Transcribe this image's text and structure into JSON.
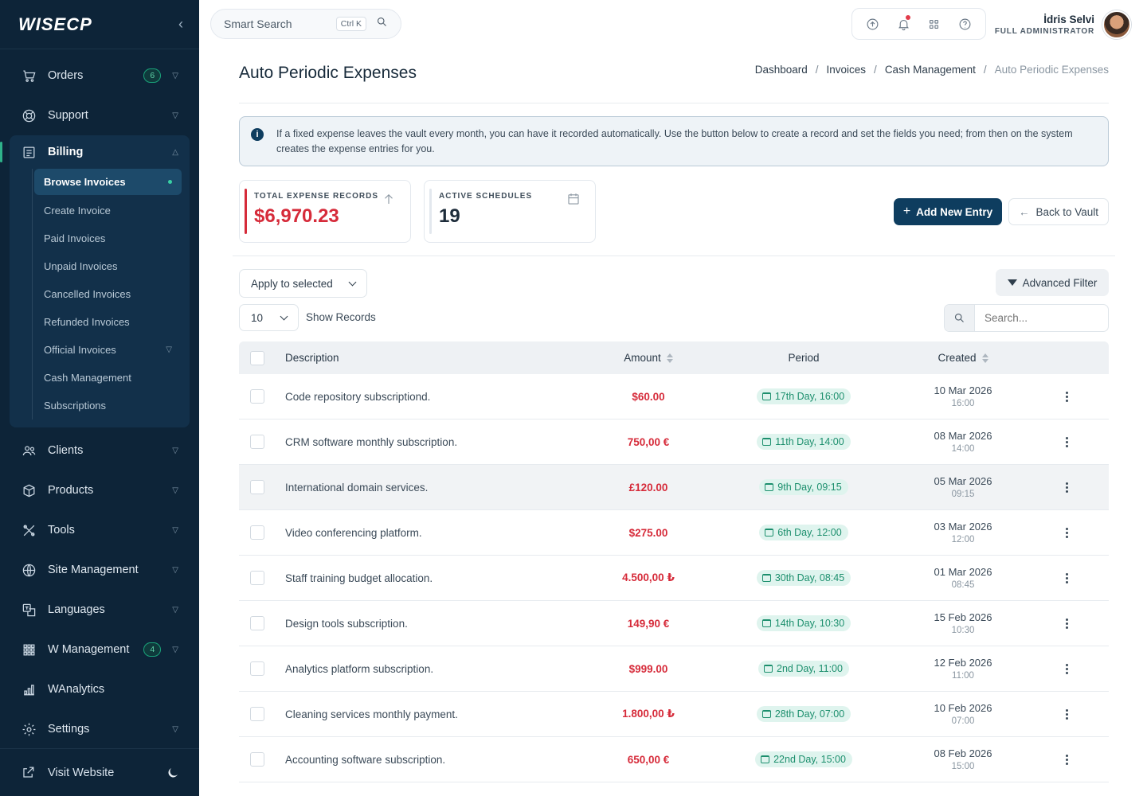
{
  "app": {
    "logo": "WISECP"
  },
  "sidebar": {
    "items_top": [
      {
        "label": "Orders",
        "badge": "6",
        "icon": "cart-icon"
      },
      {
        "label": "Support",
        "icon": "lifebuoy-icon"
      }
    ],
    "billing": {
      "label": "Billing",
      "subitems": [
        {
          "label": "Browse Invoices",
          "active": true
        },
        {
          "label": "Create Invoice"
        },
        {
          "label": "Paid Invoices"
        },
        {
          "label": "Unpaid Invoices"
        },
        {
          "label": "Cancelled Invoices"
        },
        {
          "label": "Refunded Invoices"
        },
        {
          "label": "Official Invoices",
          "chevron": true
        },
        {
          "label": "Cash Management"
        },
        {
          "label": "Subscriptions"
        }
      ]
    },
    "items_bottom": [
      {
        "label": "Clients",
        "icon": "users-icon"
      },
      {
        "label": "Products",
        "icon": "box-icon"
      },
      {
        "label": "Tools",
        "icon": "tools-icon"
      },
      {
        "label": "Site Management",
        "icon": "globe-icon"
      },
      {
        "label": "Languages",
        "icon": "translate-icon"
      },
      {
        "label": "W Management",
        "badge": "4",
        "icon": "grid-icon"
      },
      {
        "label": "WAnalytics",
        "icon": "chart-icon"
      },
      {
        "label": "Settings",
        "icon": "gear-icon"
      }
    ],
    "footer": {
      "label": "Visit Website"
    }
  },
  "topbar": {
    "search_placeholder": "Smart Search",
    "search_shortcut": "Ctrl K",
    "user_name": "İdris Selvi",
    "user_role": "FULL ADMINISTRATOR"
  },
  "page": {
    "title": "Auto Periodic Expenses",
    "breadcrumb": [
      "Dashboard",
      "Invoices",
      "Cash Management",
      "Auto Periodic Expenses"
    ],
    "info": "If a fixed expense leaves the vault every month, you can have it recorded automatically. Use the button below to create a record and set the fields you need; from then on the system creates the expense entries for you."
  },
  "stats": {
    "total_label": "TOTAL EXPENSE RECORDS",
    "total_value": "$6,970.23",
    "total_color": "#d62b3a",
    "schedules_label": "ACTIVE SCHEDULES",
    "schedules_value": "19"
  },
  "actions": {
    "add_label": "Add New Entry",
    "back_label": "Back to Vault",
    "apply_label": "Apply to selected",
    "filter_label": "Advanced Filter",
    "records_value": "10",
    "records_label": "Show Records",
    "search_placeholder": "Search..."
  },
  "table": {
    "headers": {
      "description": "Description",
      "amount": "Amount",
      "period": "Period",
      "created": "Created"
    },
    "rows": [
      {
        "description": "Code repository subscriptiond.",
        "amount": "$60.00",
        "period": "17th Day, 16:00",
        "date": "10 Mar 2026",
        "time": "16:00"
      },
      {
        "description": "CRM software monthly subscription.",
        "amount": "750,00 €",
        "period": "11th Day, 14:00",
        "date": "08 Mar 2026",
        "time": "14:00"
      },
      {
        "description": "International domain services.",
        "amount": "£120.00",
        "period": "9th Day, 09:15",
        "date": "05 Mar 2026",
        "time": "09:15",
        "highlight": true
      },
      {
        "description": "Video conferencing platform.",
        "amount": "$275.00",
        "period": "6th Day, 12:00",
        "date": "03 Mar 2026",
        "time": "12:00"
      },
      {
        "description": "Staff training budget allocation.",
        "amount": "4.500,00 ₺",
        "period": "30th Day, 08:45",
        "date": "01 Mar 2026",
        "time": "08:45"
      },
      {
        "description": "Design tools subscription.",
        "amount": "149,90 €",
        "period": "14th Day, 10:30",
        "date": "15 Feb 2026",
        "time": "10:30"
      },
      {
        "description": "Analytics platform subscription.",
        "amount": "$999.00",
        "period": "2nd Day, 11:00",
        "date": "12 Feb 2026",
        "time": "11:00"
      },
      {
        "description": "Cleaning services monthly payment.",
        "amount": "1.800,00 ₺",
        "period": "28th Day, 07:00",
        "date": "10 Feb 2026",
        "time": "07:00"
      },
      {
        "description": "Accounting software subscription.",
        "amount": "650,00 €",
        "period": "22nd Day, 15:00",
        "date": "08 Feb 2026",
        "time": "15:00"
      }
    ]
  }
}
